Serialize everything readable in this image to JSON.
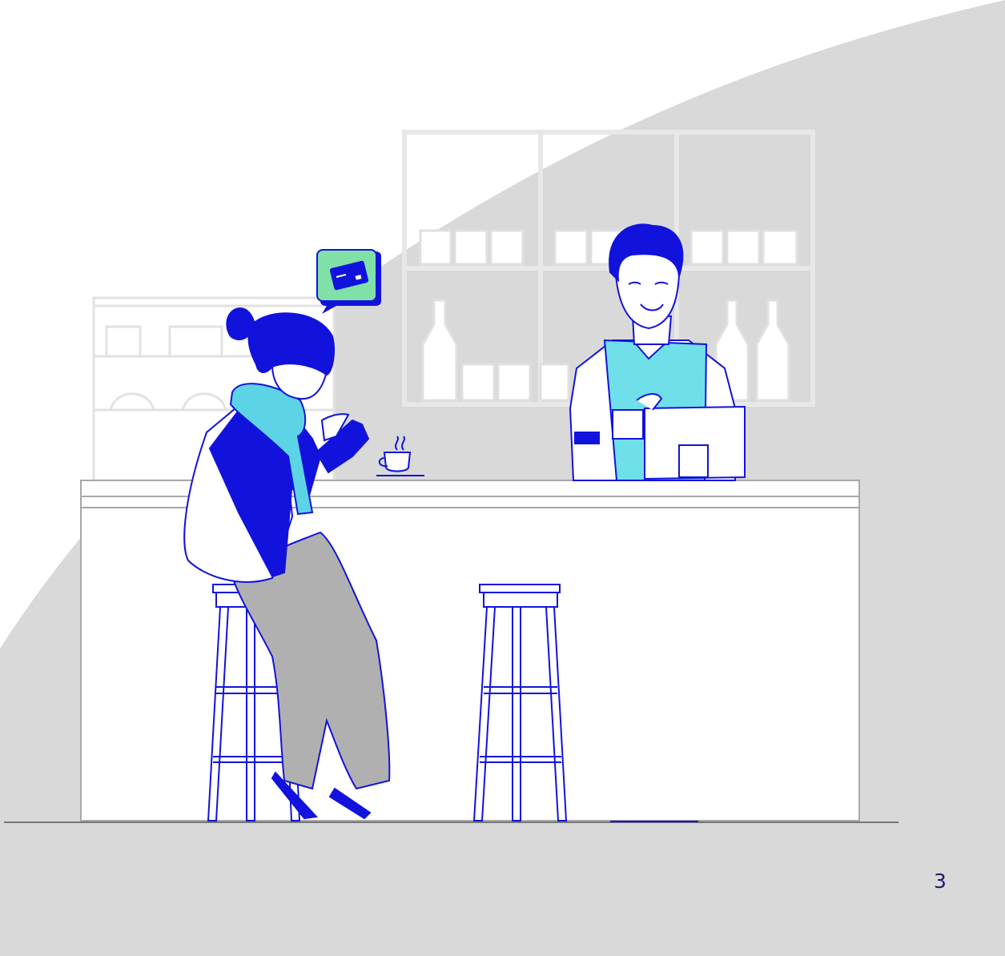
{
  "page": {
    "number": "3"
  },
  "colors": {
    "background": "#ffffff",
    "backdrop_shape": "#d9d9d9",
    "shelf_lines": "#e6e6e6",
    "ink_blue": "#1212dd",
    "scarf_cyan": "#5cd4e6",
    "apron_cyan": "#6fe0ea",
    "pants_gray": "#b0b0b0",
    "bubble_green": "#7fe0a8",
    "counter_outline": "#a9a9a9"
  },
  "icons": {
    "speech_bubble": "credit-card-icon"
  }
}
